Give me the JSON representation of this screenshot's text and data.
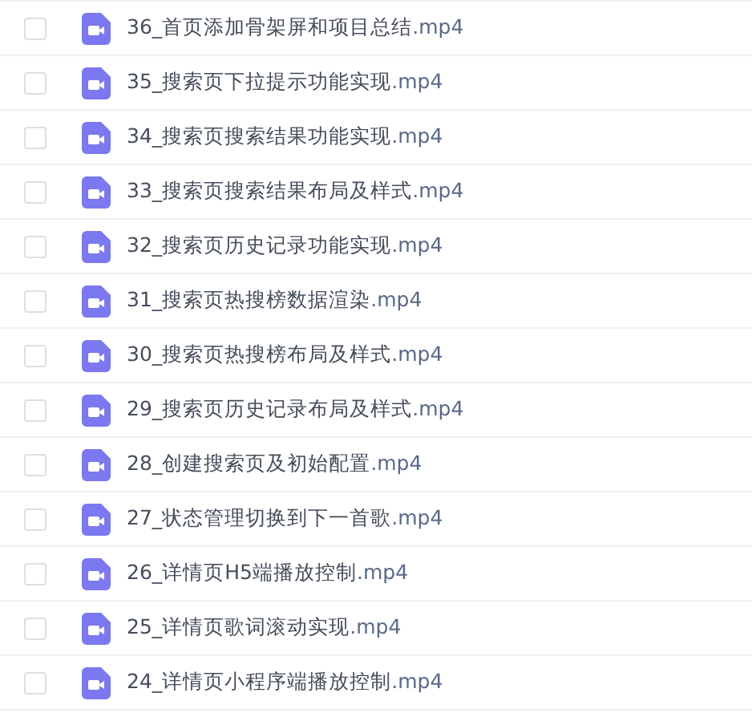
{
  "files": [
    {
      "name": "36_首页添加骨架屏和项目总结",
      "ext": ".mp4",
      "checked": false
    },
    {
      "name": "35_搜索页下拉提示功能实现",
      "ext": ".mp4",
      "checked": false
    },
    {
      "name": "34_搜索页搜索结果功能实现",
      "ext": ".mp4",
      "checked": false
    },
    {
      "name": "33_搜索页搜索结果布局及样式",
      "ext": ".mp4",
      "checked": false
    },
    {
      "name": "32_搜索页历史记录功能实现",
      "ext": ".mp4",
      "checked": false
    },
    {
      "name": "31_搜索页热搜榜数据渲染",
      "ext": ".mp4",
      "checked": false
    },
    {
      "name": "30_搜索页热搜榜布局及样式",
      "ext": ".mp4",
      "checked": false
    },
    {
      "name": "29_搜索页历史记录布局及样式",
      "ext": ".mp4",
      "checked": false
    },
    {
      "name": "28_创建搜索页及初始配置",
      "ext": ".mp4",
      "checked": false
    },
    {
      "name": "27_状态管理切换到下一首歌",
      "ext": ".mp4",
      "checked": false
    },
    {
      "name": "26_详情页H5端播放控制",
      "ext": ".mp4",
      "checked": false
    },
    {
      "name": "25_详情页歌词滚动实现",
      "ext": ".mp4",
      "checked": false
    },
    {
      "name": "24_详情页小程序端播放控制",
      "ext": ".mp4",
      "checked": false
    }
  ]
}
